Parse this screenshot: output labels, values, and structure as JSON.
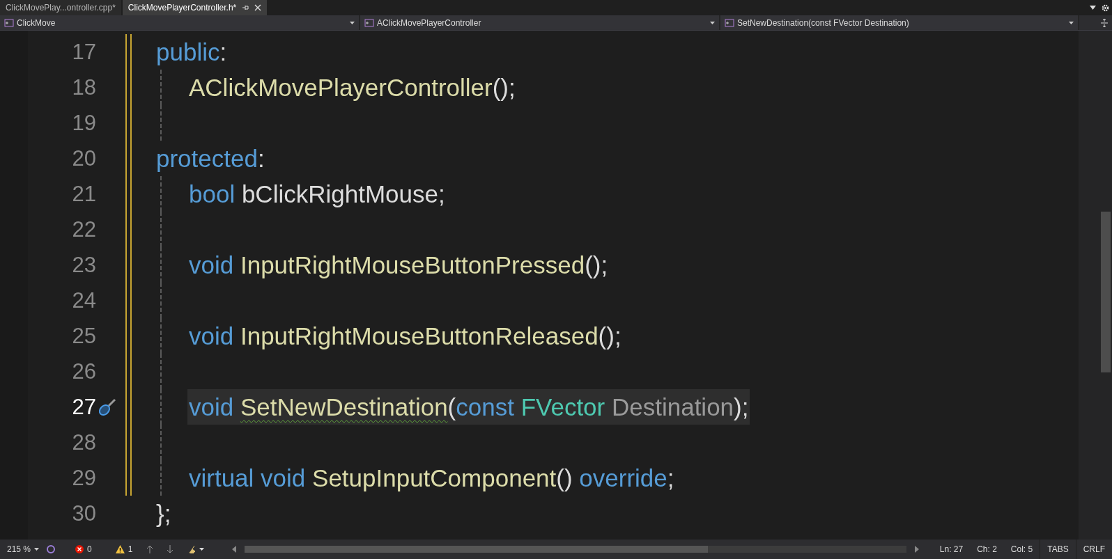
{
  "tabs": [
    {
      "label": "ClickMovePlay...ontroller.cpp*",
      "selected": false
    },
    {
      "label": "ClickMovePlayerController.h*",
      "selected": true
    }
  ],
  "nav": [
    {
      "label": "ClickMove"
    },
    {
      "label": "AClickMovePlayerController"
    },
    {
      "label": "SetNewDestination(const FVector Destination)"
    }
  ],
  "lines": [
    {
      "number": "17",
      "indented": false,
      "current": false,
      "tokens": [
        {
          "kind": "keyword",
          "text": "public"
        },
        {
          "kind": "punct",
          "text": ":"
        }
      ]
    },
    {
      "number": "18",
      "indented": true,
      "current": false,
      "tokens": [
        {
          "kind": "func",
          "text": "AClickMovePlayerController"
        },
        {
          "kind": "punct",
          "text": "();"
        }
      ]
    },
    {
      "number": "19",
      "indented": true,
      "current": false
    },
    {
      "number": "20",
      "indented": false,
      "current": false,
      "tokens": [
        {
          "kind": "keyword",
          "text": "protected"
        },
        {
          "kind": "punct",
          "text": ":"
        }
      ]
    },
    {
      "number": "21",
      "indented": true,
      "current": false,
      "tokens": [
        {
          "kind": "keyword",
          "text": "bool "
        },
        {
          "kind": "plain",
          "text": "bClickRightMouse;"
        }
      ]
    },
    {
      "number": "22",
      "indented": true,
      "current": false
    },
    {
      "number": "23",
      "indented": true,
      "current": false,
      "tokens": [
        {
          "kind": "keyword",
          "text": "void "
        },
        {
          "kind": "func",
          "text": "InputRightMouseButtonPressed"
        },
        {
          "kind": "punct",
          "text": "();"
        }
      ]
    },
    {
      "number": "24",
      "indented": true,
      "current": false
    },
    {
      "number": "25",
      "indented": true,
      "current": false,
      "tokens": [
        {
          "kind": "keyword",
          "text": "void "
        },
        {
          "kind": "func",
          "text": "InputRightMouseButtonReleased"
        },
        {
          "kind": "punct",
          "text": "();"
        }
      ]
    },
    {
      "number": "26",
      "indented": true,
      "current": false
    },
    {
      "number": "27",
      "indented": true,
      "current": true,
      "tokens": [
        {
          "kind": "keyword",
          "text": "void "
        },
        {
          "kind": "func",
          "text": "SetNewDestination",
          "squiggle": true
        },
        {
          "kind": "punct",
          "text": "("
        },
        {
          "kind": "keyword",
          "text": "const "
        },
        {
          "kind": "type",
          "text": "FVector "
        },
        {
          "kind": "param",
          "text": "Destination"
        },
        {
          "kind": "punct",
          "text": ");"
        }
      ]
    },
    {
      "number": "28",
      "indented": true,
      "current": false
    },
    {
      "number": "29",
      "indented": true,
      "current": false,
      "tokens": [
        {
          "kind": "keyword",
          "text": "virtual void "
        },
        {
          "kind": "func",
          "text": "SetupInputComponent"
        },
        {
          "kind": "punct",
          "text": "() "
        },
        {
          "kind": "keyword",
          "text": "override"
        },
        {
          "kind": "punct",
          "text": ";"
        }
      ]
    },
    {
      "number": "30",
      "indented": false,
      "current": false,
      "tokens": [
        {
          "kind": "punct",
          "text": "};"
        }
      ]
    }
  ],
  "status": {
    "zoom": "215 %",
    "errors": "0",
    "warnings": "1",
    "ln": "Ln: 27",
    "ch": "Ch: 2",
    "col": "Col: 5",
    "indent": "TABS",
    "eol": "CRLF"
  }
}
